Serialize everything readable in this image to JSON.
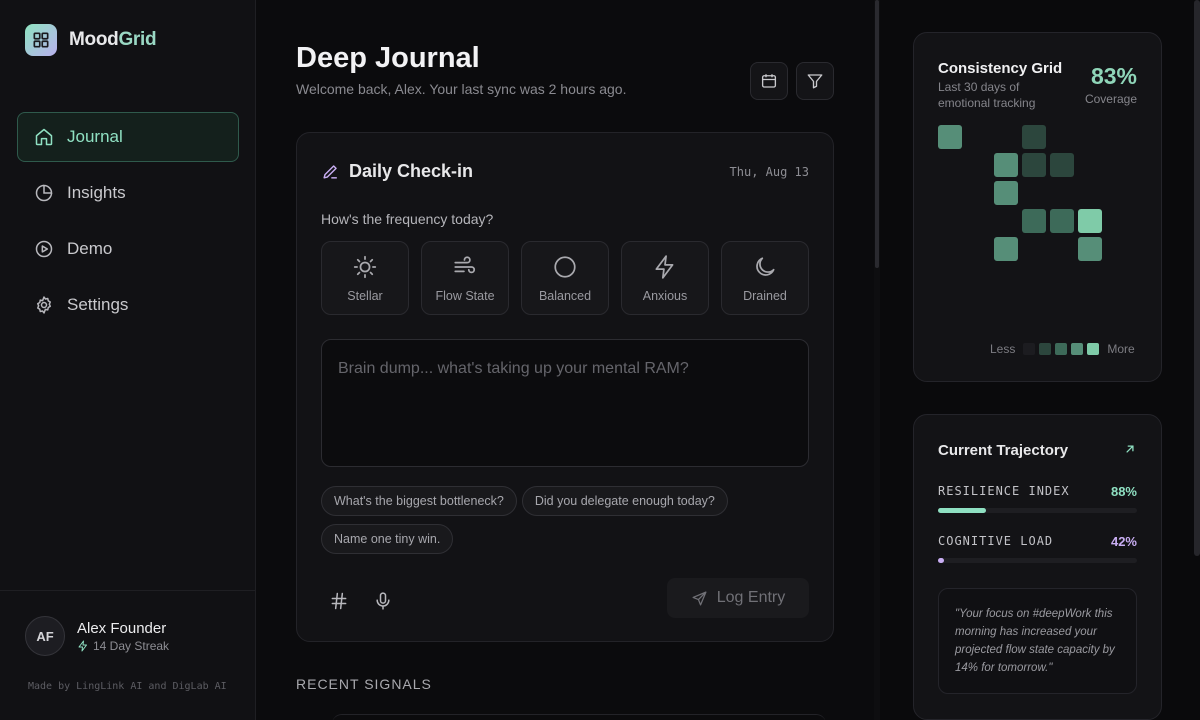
{
  "app": {
    "logo_part1": "Mood",
    "logo_part2": "Grid"
  },
  "sidebar": {
    "items": [
      {
        "label": "Journal",
        "icon": "home-icon",
        "active": true
      },
      {
        "label": "Insights",
        "icon": "pie-chart-icon",
        "active": false
      },
      {
        "label": "Demo",
        "icon": "play-circle-icon",
        "active": false
      },
      {
        "label": "Settings",
        "icon": "gear-icon",
        "active": false
      }
    ],
    "profile": {
      "initials": "AF",
      "name": "Alex Founder",
      "streak": "14 Day Streak"
    },
    "credit": "Made by LingLink AI and DigLab AI"
  },
  "header": {
    "title": "Deep Journal",
    "subtitle": "Welcome back, Alex. Your last sync was 2 hours ago."
  },
  "checkin": {
    "title": "Daily Check-in",
    "date": "Thu, Aug 13",
    "question": "How's the frequency today?",
    "moods": [
      {
        "label": "Stellar",
        "icon": "sun-icon"
      },
      {
        "label": "Flow State",
        "icon": "wind-icon"
      },
      {
        "label": "Balanced",
        "icon": "circle-icon"
      },
      {
        "label": "Anxious",
        "icon": "zap-icon"
      },
      {
        "label": "Drained",
        "icon": "moon-icon"
      }
    ],
    "placeholder": "Brain dump... what's taking up your mental RAM?",
    "prompts": [
      "What's the biggest bottleneck?",
      "Did you delegate enough today?",
      "Name one tiny win."
    ],
    "log_label": "Log Entry"
  },
  "recent": {
    "heading": "RECENT SIGNALS"
  },
  "grid_card": {
    "title": "Consistency Grid",
    "subtitle": "Last 30 days of emotional tracking",
    "coverage_value": "83%",
    "coverage_label": "Coverage",
    "legend_less": "Less",
    "legend_more": "More",
    "colors": [
      "#1c1c20",
      "#2c463d",
      "#3d6a59",
      "#568e78",
      "#7fcba8"
    ],
    "levels": [
      3,
      0,
      0,
      0,
      0,
      0,
      0,
      0,
      0,
      0,
      0,
      3,
      3,
      0,
      3,
      1,
      1,
      0,
      2,
      0,
      0,
      1,
      0,
      2,
      0,
      0,
      0,
      0,
      4,
      3
    ]
  },
  "trajectory": {
    "title": "Current Trajectory",
    "metrics": [
      {
        "label": "RESILIENCE INDEX",
        "value": "88%",
        "fill": 0.24,
        "color": "#8fe0c2"
      },
      {
        "label": "COGNITIVE LOAD",
        "value": "42%",
        "fill": 0.03,
        "color": "#c9aef3"
      }
    ],
    "insight": "\"Your focus on #deepWork this morning has increased your projected flow state capacity by 14% for tomorrow.\""
  }
}
